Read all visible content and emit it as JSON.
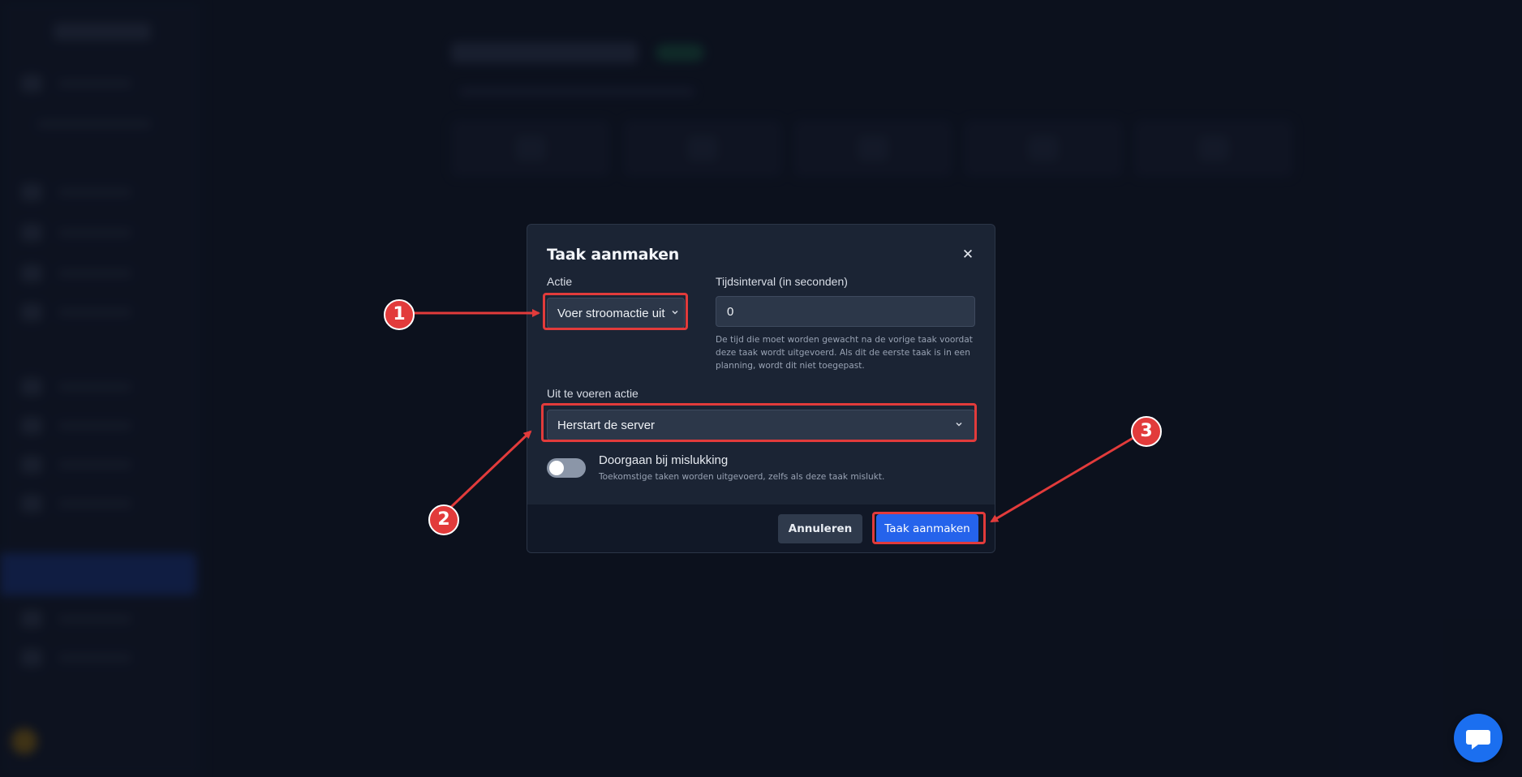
{
  "modal": {
    "title": "Taak aanmaken",
    "close_icon": "close-icon",
    "action_label": "Actie",
    "action_value": "Voer stroomactie uit",
    "interval_label": "Tijdsinterval (in seconden)",
    "interval_value": "0",
    "interval_help": "De tijd die moet worden gewacht na de vorige taak voordat deze taak wordt uitgevoerd. Als dit de eerste taak is in een planning, wordt dit niet toegepast.",
    "perform_label": "Uit te voeren actie",
    "perform_value": "Herstart de server",
    "continue_title": "Doorgaan bij mislukking",
    "continue_help": "Toekomstige taken worden uitgevoerd, zelfs als deze taak mislukt.",
    "continue_enabled": false,
    "cancel_label": "Annuleren",
    "create_label": "Taak aanmaken"
  },
  "annotations": {
    "badge_1": "1",
    "badge_2": "2",
    "badge_3": "3",
    "color": "#e23b3b"
  },
  "colors": {
    "primary_button": "#2563eb",
    "modal_bg": "#1b2434",
    "page_bg": "#0f1624"
  },
  "chat": {
    "icon": "chat-bubble-icon"
  }
}
